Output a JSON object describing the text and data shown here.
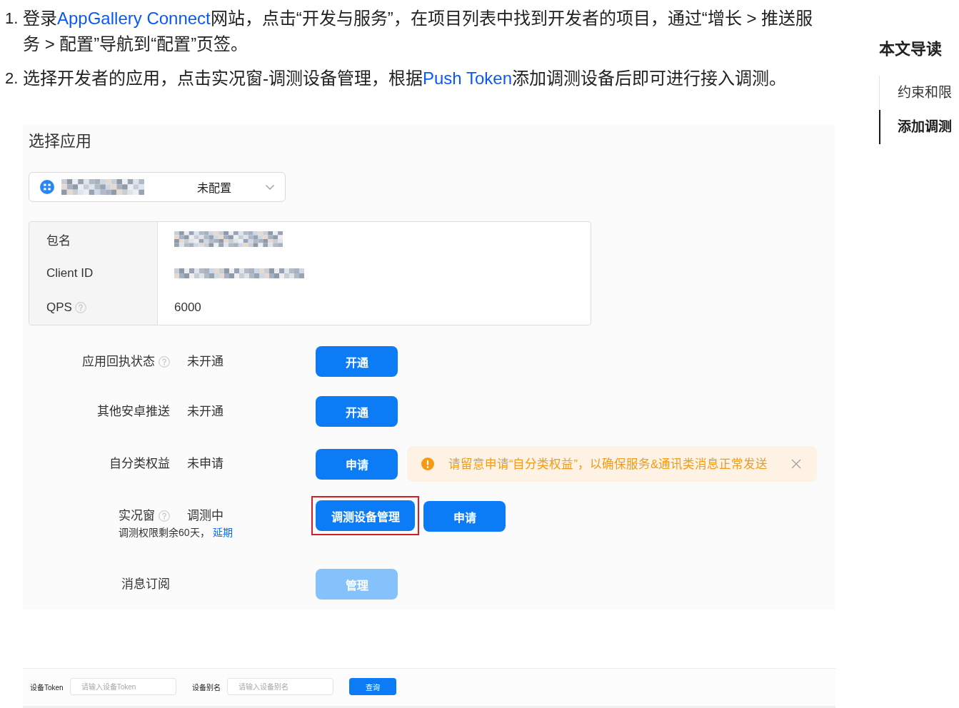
{
  "steps": [
    {
      "number": "1.",
      "segments": [
        {
          "kind": "text",
          "text": "登录"
        },
        {
          "kind": "link",
          "text": "AppGallery Connect"
        },
        {
          "kind": "text",
          "text": "网站，点击“开发与服务”，在项目列表中找到开发者的项目，通过“增长 > 推送服务 > 配置”导航到“配置”页签。"
        }
      ]
    },
    {
      "number": "2.",
      "segments": [
        {
          "kind": "text",
          "text": "选择开发者的应用，点击实况窗-调测设备管理，根据"
        },
        {
          "kind": "link",
          "text": "Push Token"
        },
        {
          "kind": "text",
          "text": "添加调测设备后即可进行接入调测。"
        }
      ]
    }
  ],
  "app_screenshot": {
    "title": "选择应用",
    "app_select": {
      "app_name_redacted": true,
      "status": "未配置"
    },
    "info_table": [
      {
        "label": "包名",
        "help": false,
        "redacted": true
      },
      {
        "label": "Client ID",
        "help": false,
        "redacted": true
      },
      {
        "label": "QPS",
        "help": true,
        "redacted": false,
        "value": "6000"
      }
    ],
    "settings": [
      {
        "label": "应用回执状态",
        "help": true,
        "status": "未开通",
        "buttons": [
          {
            "label": "开通",
            "disabled": false,
            "highlighted": false
          }
        ]
      },
      {
        "label": "其他安卓推送",
        "help": false,
        "status": "未开通",
        "buttons": [
          {
            "label": "开通",
            "disabled": false,
            "highlighted": false
          }
        ]
      },
      {
        "label": "自分类权益",
        "help": false,
        "status": "未申请",
        "buttons": [
          {
            "label": "申请",
            "disabled": false,
            "highlighted": false
          }
        ],
        "alert": {
          "text": "请留意申请“自分类权益”，以确保服务&通讯类消息正常发送"
        }
      },
      {
        "label": "实况窗",
        "help": true,
        "status": "调测中",
        "note": {
          "text": "调测权限剩余60天，",
          "link": "延期"
        },
        "buttons": [
          {
            "label": "调测设备管理",
            "disabled": false,
            "highlighted": true
          },
          {
            "label": "申请",
            "disabled": false,
            "highlighted": false
          }
        ]
      },
      {
        "label": "消息订阅",
        "help": false,
        "buttons": [
          {
            "label": "管理",
            "disabled": true,
            "highlighted": false
          }
        ]
      }
    ]
  },
  "query_screenshot": {
    "fields": [
      {
        "label": "设备Token",
        "placeholder": "请输入设备Token"
      },
      {
        "label": "设备别名",
        "placeholder": "请输入设备别名"
      }
    ],
    "button": "查询"
  },
  "toc": {
    "title": "本文导读",
    "items": [
      {
        "label": "约束和限",
        "selected": false
      },
      {
        "label": "添加调测",
        "selected": true
      }
    ]
  }
}
